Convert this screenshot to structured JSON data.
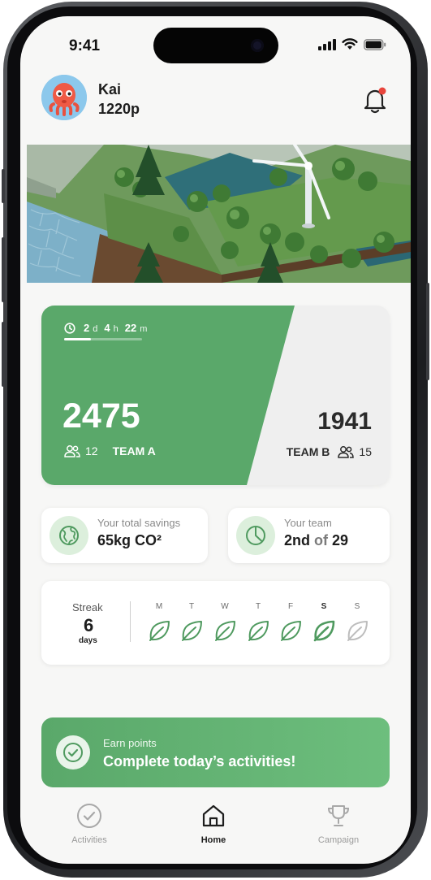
{
  "status_bar": {
    "time": "9:41",
    "icons": [
      "cellular-signal-icon",
      "wifi-icon",
      "battery-icon"
    ]
  },
  "header": {
    "user_name": "Kai",
    "user_points": "1220p",
    "avatar": "octopus-avatar",
    "notification_icon": "bell-icon"
  },
  "competition": {
    "timer": {
      "days": "2",
      "days_unit": "d",
      "hours": "4",
      "hours_unit": "h",
      "minutes": "22",
      "minutes_unit": "m"
    },
    "team_a": {
      "score": "2475",
      "members": "12",
      "name": "TEAM A"
    },
    "team_b": {
      "score": "1941",
      "members": "15",
      "name": "TEAM B"
    }
  },
  "stats": {
    "savings": {
      "label": "Your total savings",
      "value": "65kg CO²",
      "icon": "earth-icon"
    },
    "team_rank": {
      "label": "Your team",
      "rank": "2nd",
      "of": "of",
      "total": "29",
      "icon": "pie-chart-icon"
    }
  },
  "streak": {
    "label": "Streak",
    "count": "6",
    "unit": "days",
    "days": [
      {
        "letter": "M",
        "done": true
      },
      {
        "letter": "T",
        "done": true
      },
      {
        "letter": "W",
        "done": true
      },
      {
        "letter": "T",
        "done": true
      },
      {
        "letter": "F",
        "done": true
      },
      {
        "letter": "S",
        "done": true,
        "today": true
      },
      {
        "letter": "S",
        "done": false
      }
    ]
  },
  "cta": {
    "subtitle": "Earn points",
    "title": "Complete today’s activities!",
    "icon": "check-circle-icon"
  },
  "tabs": [
    {
      "label": "Activities",
      "icon": "check-circle-icon",
      "active": false
    },
    {
      "label": "Home",
      "icon": "home-icon",
      "active": true
    },
    {
      "label": "Campaign",
      "icon": "trophy-icon",
      "active": false
    }
  ],
  "colors": {
    "primary_green": "#5aa86a",
    "light_green": "#dcefdc",
    "leaf_done": "#4f9a5f",
    "leaf_pending": "#bdbdbd",
    "notification_dot": "#e8453c"
  }
}
